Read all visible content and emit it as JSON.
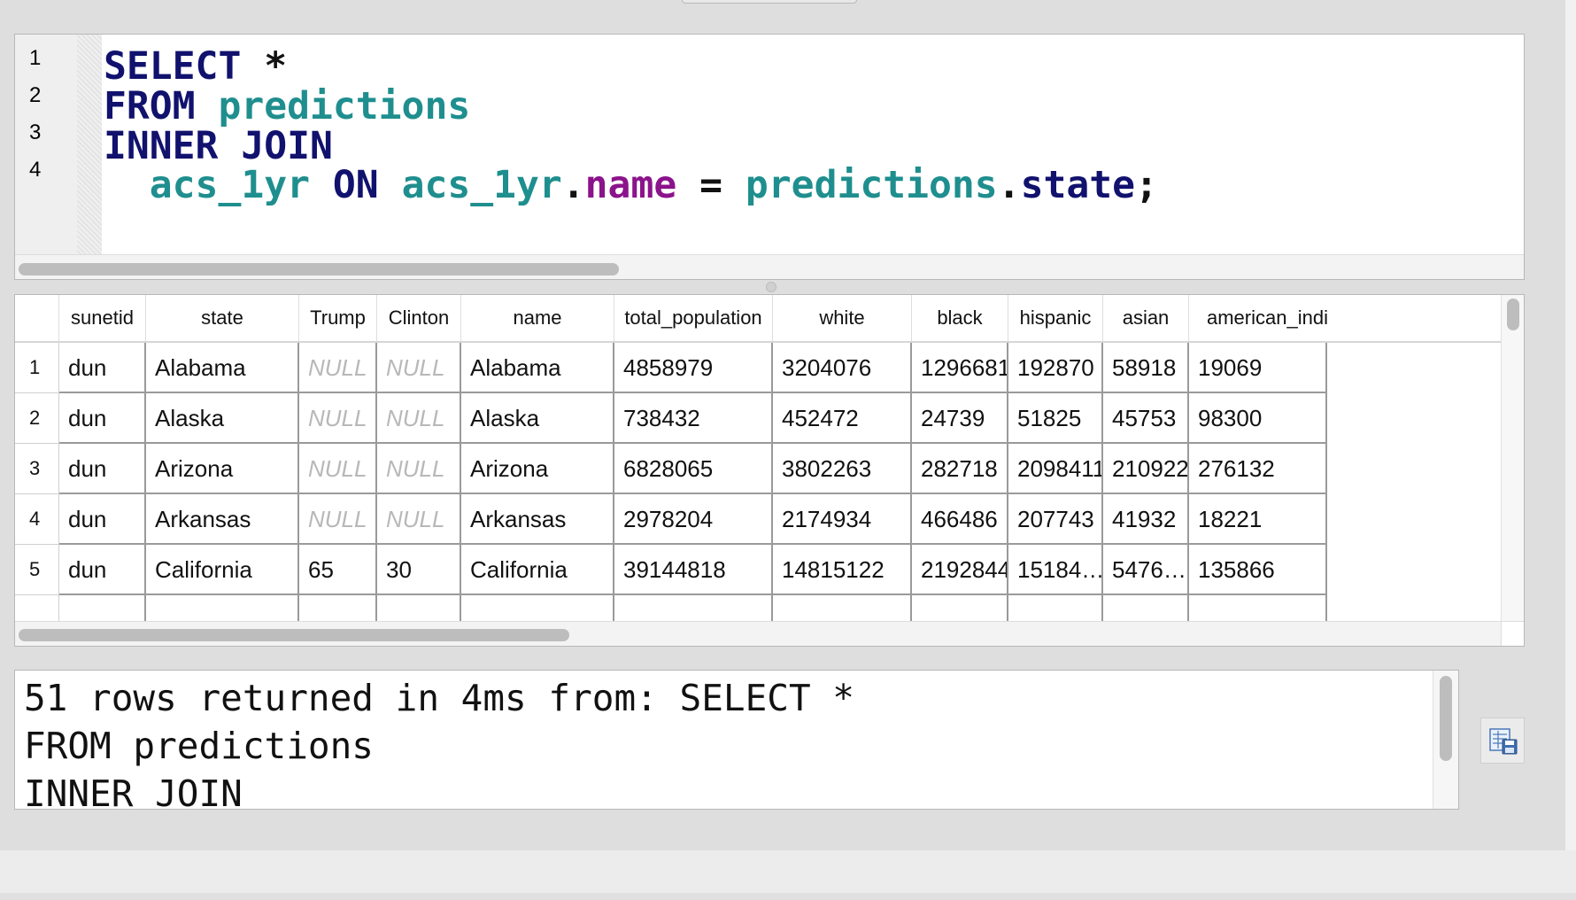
{
  "editor": {
    "line_numbers": [
      "1",
      "2",
      "3",
      "4"
    ],
    "lines": [
      [
        {
          "t": "SELECT",
          "c": "kw"
        },
        {
          "t": " *",
          "c": "op"
        }
      ],
      [
        {
          "t": "FROM",
          "c": "kw"
        },
        {
          "t": " ",
          "c": "op"
        },
        {
          "t": "predictions",
          "c": "id"
        }
      ],
      [
        {
          "t": "INNER JOIN",
          "c": "kw"
        }
      ],
      [
        {
          "t": "  ",
          "c": "op"
        },
        {
          "t": "acs_1yr",
          "c": "id"
        },
        {
          "t": " ",
          "c": "op"
        },
        {
          "t": "ON",
          "c": "kw"
        },
        {
          "t": " ",
          "c": "op"
        },
        {
          "t": "acs_1yr",
          "c": "id"
        },
        {
          "t": ".",
          "c": "op"
        },
        {
          "t": "name",
          "c": "col"
        },
        {
          "t": " = ",
          "c": "op"
        },
        {
          "t": "predictions",
          "c": "id"
        },
        {
          "t": ".",
          "c": "op"
        },
        {
          "t": "state",
          "c": "kw"
        },
        {
          "t": ";",
          "c": "op"
        }
      ]
    ]
  },
  "results": {
    "columns": [
      "sunetid",
      "state",
      "Trump",
      "Clinton",
      "name",
      "total_population",
      "white",
      "black",
      "hispanic",
      "asian",
      "american_india"
    ],
    "rows": [
      {
        "n": "1",
        "cells": [
          "dun",
          "Alabama",
          "NULL",
          "NULL",
          "Alabama",
          "4858979",
          "3204076",
          "1296681",
          "192870",
          "58918",
          "19069"
        ]
      },
      {
        "n": "2",
        "cells": [
          "dun",
          "Alaska",
          "NULL",
          "NULL",
          "Alaska",
          "738432",
          "452472",
          "24739",
          "51825",
          "45753",
          "98300"
        ]
      },
      {
        "n": "3",
        "cells": [
          "dun",
          "Arizona",
          "NULL",
          "NULL",
          "Arizona",
          "6828065",
          "3802263",
          "282718",
          "2098411",
          "210922",
          "276132"
        ]
      },
      {
        "n": "4",
        "cells": [
          "dun",
          "Arkansas",
          "NULL",
          "NULL",
          "Arkansas",
          "2978204",
          "2174934",
          "466486",
          "207743",
          "41932",
          "18221"
        ]
      },
      {
        "n": "5",
        "cells": [
          "dun",
          "California",
          "65",
          "30",
          "California",
          "39144818",
          "14815122",
          "2192844",
          "15184…",
          "5476…",
          "135866"
        ]
      }
    ]
  },
  "message": {
    "lines": [
      "51 rows returned in 4ms from: SELECT *",
      "FROM predictions",
      "INNER JOIN"
    ]
  },
  "save_button": {
    "icon": "save-results-icon"
  }
}
